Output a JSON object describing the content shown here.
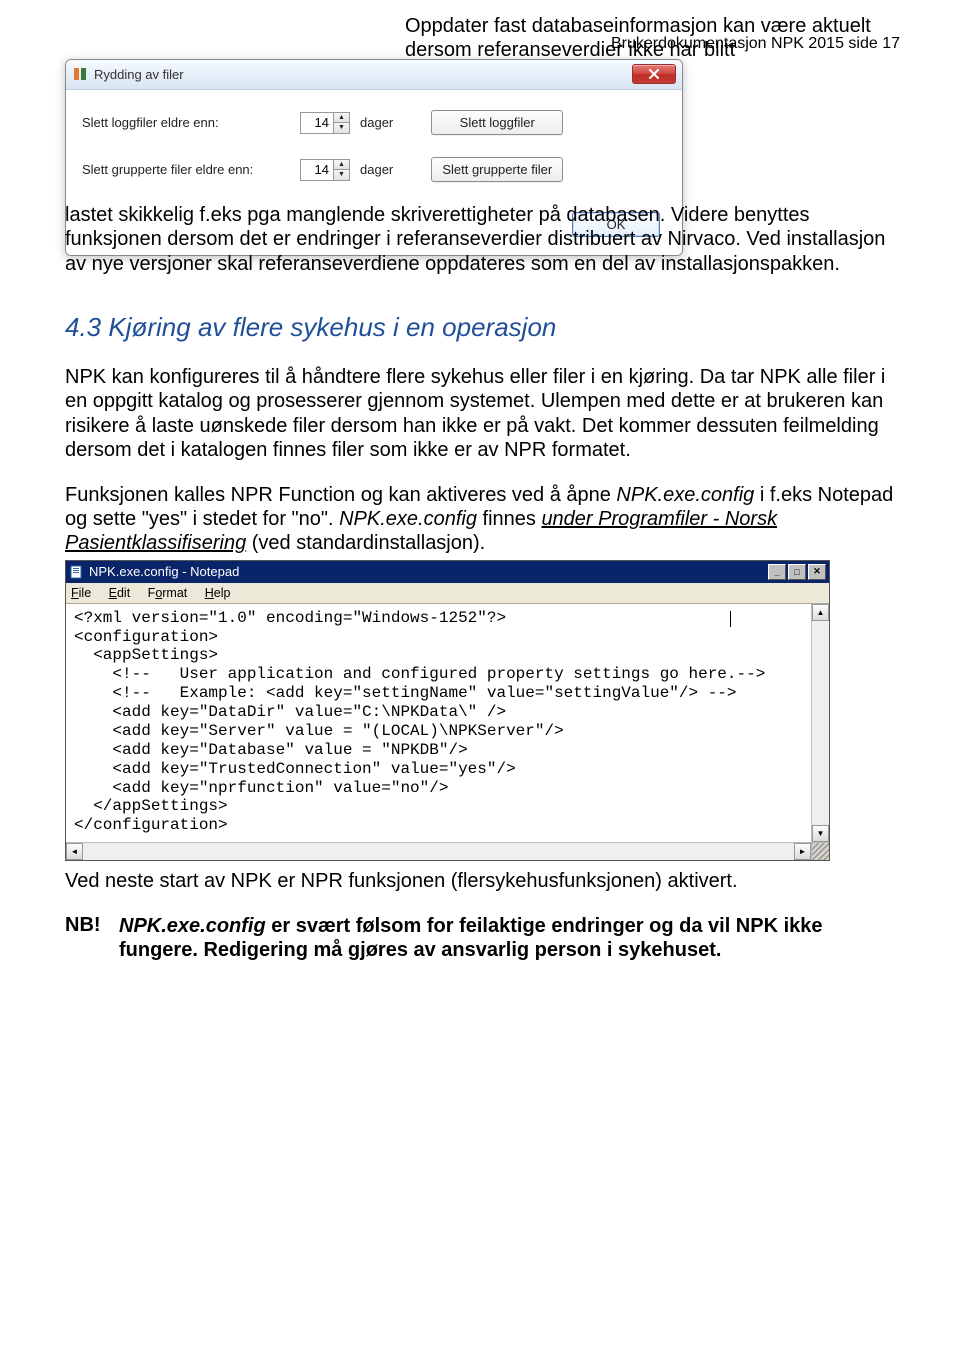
{
  "header": {
    "right": "Brukerdokumentasjon NPK 2015 side 17"
  },
  "dialog": {
    "title": "Rydding av filer",
    "row1_label": "Slett loggfiler eldre enn:",
    "row1_value": "14",
    "row1_unit": "dager",
    "row1_button": "Slett loggfiler",
    "row2_label": "Slett grupperte filer eldre enn:",
    "row2_value": "14",
    "row2_unit": "dager",
    "row2_button": "Slett grupperte filer",
    "ok": "OK"
  },
  "para1_a": "Oppdater fast databaseinformasjon kan være aktuelt dersom referanseverdier ikke har blitt ",
  "para1_b": "lastet skikkelig f.eks pga manglende skriverettigheter på databasen. Videre benyttes funksjonen dersom det er endringer i referanseverdier distribuert av Nirvaco. Ved installasjon av nye versjoner skal referanseverdiene oppdateres som en del av installasjonspakken.",
  "heading": "4.3 Kjøring av flere sykehus i en operasjon",
  "para2": "NPK kan konfigureres til å håndtere flere sykehus eller filer i en kjøring. Da tar NPK alle filer i en oppgitt katalog og prosesserer gjennom systemet. Ulempen med dette er at brukeren kan risikere å laste uønskede filer dersom han ikke er på vakt. Det kommer dessuten feilmelding dersom det i katalogen finnes filer som ikke er av NPR formatet.",
  "para3_a": "Funksjonen kalles NPR Function og kan aktiveres ved å åpne ",
  "para3_b": "NPK.exe.config",
  "para3_c": " i f.eks Notepad og sette \"yes\" i stedet for \"no\". ",
  "para3_d": "NPK.exe.config",
  "para3_e": " finnes ",
  "para3_f": "under Programfiler - Norsk Pasientklassifisering",
  "para3_g": " (ved standardinstallasjon).",
  "notepad": {
    "title": "NPK.exe.config - Notepad",
    "menu": {
      "file": "File",
      "edit": "Edit",
      "format": "Format",
      "help": "Help"
    },
    "content": "<?xml version=\"1.0\" encoding=\"Windows-1252\"?>\n<configuration>\n  <appSettings>\n    <!--   User application and configured property settings go here.-->\n    <!--   Example: <add key=\"settingName\" value=\"settingValue\"/> -->\n    <add key=\"DataDir\" value=\"C:\\NPKData\\\" />\n    <add key=\"Server\" value = \"(LOCAL)\\NPKServer\"/>\n    <add key=\"Database\" value = \"NPKDB\"/>\n    <add key=\"TrustedConnection\" value=\"yes\"/>\n    <add key=\"nprfunction\" value=\"no\"/>\n  </appSettings>\n</configuration>"
  },
  "para4": "Ved neste start av NPK er NPR funksjonen (flersykehusfunksjonen) aktivert.",
  "final_nb": "NB!",
  "final_a": "NPK.exe.config",
  "final_b": " er svært følsom for feilaktige endringer og da vil NPK ikke fungere.  Redigering må gjøres av ansvarlig person i sykehuset."
}
